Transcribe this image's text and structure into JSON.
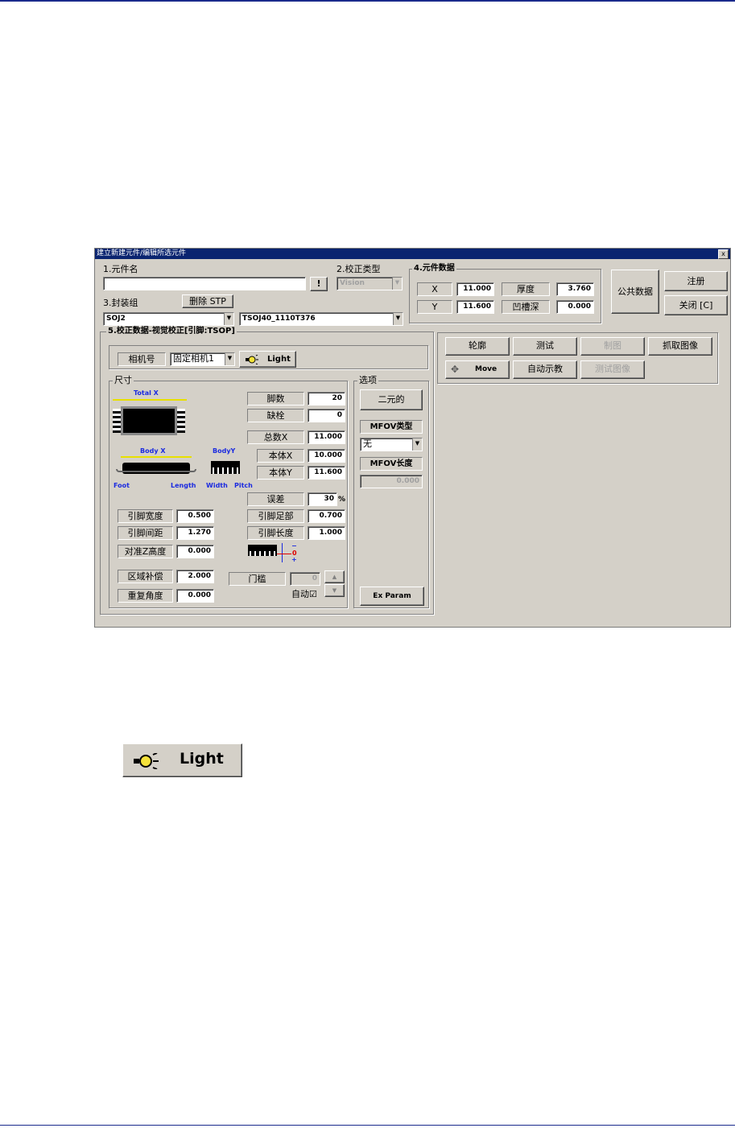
{
  "window": {
    "title": "建立新建元件/编辑所选元件",
    "close_label": "x"
  },
  "part_name": {
    "label": "1.元件名",
    "value": "",
    "button_label": "!"
  },
  "calib_type": {
    "label": "2.校正类型",
    "value": "Vision"
  },
  "package_group": {
    "label": "3.封装组",
    "delete_label": "删除 STP",
    "group_value": "SOJ2",
    "package_value": "TSOJ40_1110T376"
  },
  "part_data": {
    "label": "4.元件数据",
    "x_label": "X",
    "x_value": "11.000",
    "y_label": "Y",
    "y_value": "11.600",
    "thickness_label": "厚度",
    "thickness_value": "3.760",
    "groove_label": "凹槽深",
    "groove_value": "0.000"
  },
  "right_buttons": {
    "public_data": "公共数据",
    "register": "注册",
    "close": "关闭 [C]"
  },
  "action_buttons": {
    "outline": "轮廓",
    "test": "测试",
    "draw": "制图",
    "capture": "抓取图像",
    "move": "Move",
    "auto_teach": "自动示教",
    "test_image": "测试图像"
  },
  "calib_data": {
    "label": "5.校正数据-视觉校正[引脚:TSOP]",
    "camera_label": "相机号",
    "camera_value": "固定相机1",
    "light_label": "Light"
  },
  "size": {
    "label": "尺寸",
    "diagram": {
      "total_x": "Total X",
      "body_x": "Body X",
      "body_y": "BodyY",
      "foot": "Foot",
      "length": "Length",
      "width": "Width",
      "pitch": "Pitch",
      "minus": "−",
      "zero": "0",
      "plus": "+"
    },
    "pins_label": "脚数",
    "pins_value": "20",
    "missing_label": "缺栓",
    "missing_value": "0",
    "total_x_label": "总数X",
    "total_x_value": "11.000",
    "body_x_label": "本体X",
    "body_x_value": "10.000",
    "body_y_label": "本体Y",
    "body_y_value": "11.600",
    "tolerance_label": "误差",
    "tolerance_value": "30",
    "tolerance_unit": "%",
    "lead_width_label": "引脚宽度",
    "lead_width_value": "0.500",
    "lead_foot_label": "引脚足部",
    "lead_foot_value": "0.700",
    "lead_pitch_label": "引脚间距",
    "lead_pitch_value": "1.270",
    "lead_length_label": "引脚长度",
    "lead_length_value": "1.000",
    "z_height_label": "对准Z高度",
    "z_height_value": "0.000",
    "area_comp_label": "区域补偿",
    "area_comp_value": "2.000",
    "threshold_label": "门槛",
    "threshold_value": "0",
    "repeat_angle_label": "重复角度",
    "repeat_angle_value": "0.000",
    "auto_label": "自动☑"
  },
  "options": {
    "label": "选项",
    "binary_label": "二元的",
    "mfov_type_label": "MFOV类型",
    "mfov_type_value": "无",
    "mfov_length_label": "MFOV长度",
    "mfov_length_value": "0.000",
    "ex_param_label": "Ex Param"
  },
  "big_light_label": "Light"
}
